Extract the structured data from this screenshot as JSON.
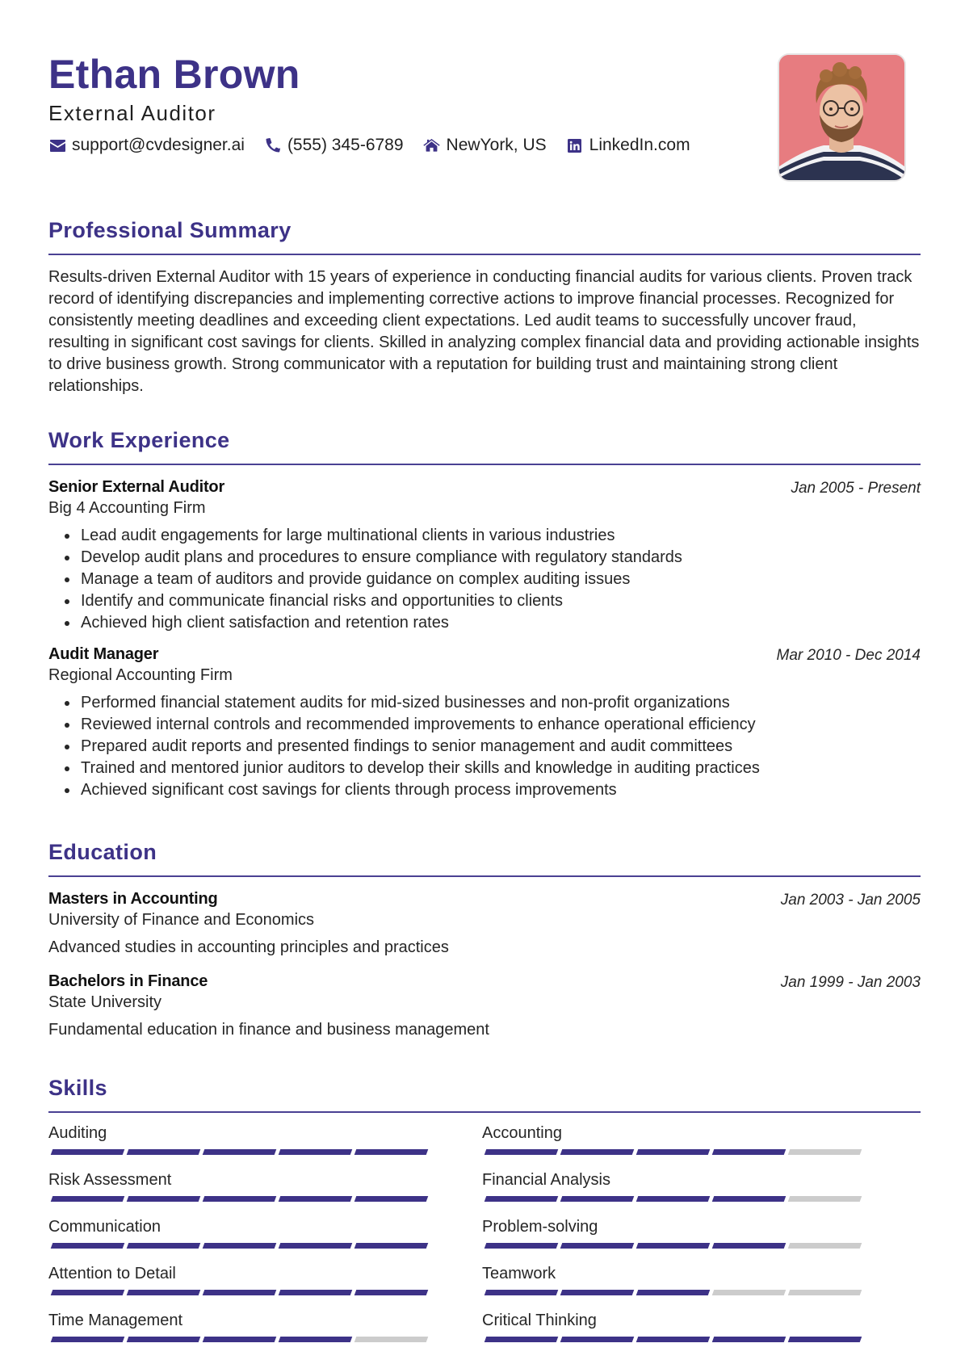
{
  "header": {
    "name": "Ethan Brown",
    "title": "External Auditor",
    "contacts": [
      {
        "icon": "envelope-icon",
        "text": "support@cvdesigner.ai"
      },
      {
        "icon": "phone-icon",
        "text": "(555) 345-6789"
      },
      {
        "icon": "home-icon",
        "text": "NewYork, US"
      },
      {
        "icon": "linkedin-icon",
        "text": "LinkedIn.com"
      }
    ]
  },
  "colors": {
    "accent": "#3d3287",
    "photo_bg": "#e77c80",
    "bar_empty": "#cccccc"
  },
  "summary": {
    "heading": "Professional Summary",
    "text": "Results-driven External Auditor with 15 years of experience in conducting financial audits for various clients. Proven track record of identifying discrepancies and implementing corrective actions to improve financial processes. Recognized for consistently meeting deadlines and exceeding client expectations. Led audit teams to successfully uncover fraud, resulting in significant cost savings for clients. Skilled in analyzing complex financial data and providing actionable insights to drive business growth. Strong communicator with a reputation for building trust and maintaining strong client relationships."
  },
  "experience": {
    "heading": "Work Experience",
    "jobs": [
      {
        "title": "Senior External Auditor",
        "company": "Big 4 Accounting Firm",
        "dates": "Jan 2005 - Present",
        "bullets": [
          "Lead audit engagements for large multinational clients in various industries",
          "Develop audit plans and procedures to ensure compliance with regulatory standards",
          "Manage a team of auditors and provide guidance on complex auditing issues",
          "Identify and communicate financial risks and opportunities to clients",
          "Achieved high client satisfaction and retention rates"
        ]
      },
      {
        "title": "Audit Manager",
        "company": "Regional Accounting Firm",
        "dates": "Mar 2010 - Dec 2014",
        "bullets": [
          "Performed financial statement audits for mid-sized businesses and non-profit organizations",
          "Reviewed internal controls and recommended improvements to enhance operational efficiency",
          "Prepared audit reports and presented findings to senior management and audit committees",
          "Trained and mentored junior auditors to develop their skills and knowledge in auditing practices",
          "Achieved significant cost savings for clients through process improvements"
        ]
      }
    ]
  },
  "education": {
    "heading": "Education",
    "items": [
      {
        "degree": "Masters in Accounting",
        "school": "University of Finance and Economics",
        "dates": "Jan 2003 - Jan 2005",
        "description": "Advanced studies in accounting principles and practices"
      },
      {
        "degree": "Bachelors in Finance",
        "school": "State University",
        "dates": "Jan 1999 - Jan 2003",
        "description": "Fundamental education in finance and business management"
      }
    ]
  },
  "skills": {
    "heading": "Skills",
    "max_level": 5,
    "items": [
      {
        "name": "Auditing",
        "level": 5
      },
      {
        "name": "Accounting",
        "level": 4
      },
      {
        "name": "Risk Assessment",
        "level": 5
      },
      {
        "name": "Financial Analysis",
        "level": 4
      },
      {
        "name": "Communication",
        "level": 5
      },
      {
        "name": "Problem-solving",
        "level": 4
      },
      {
        "name": "Attention to Detail",
        "level": 5
      },
      {
        "name": "Teamwork",
        "level": 3
      },
      {
        "name": "Time Management",
        "level": 4
      },
      {
        "name": "Critical Thinking",
        "level": 5
      }
    ]
  }
}
